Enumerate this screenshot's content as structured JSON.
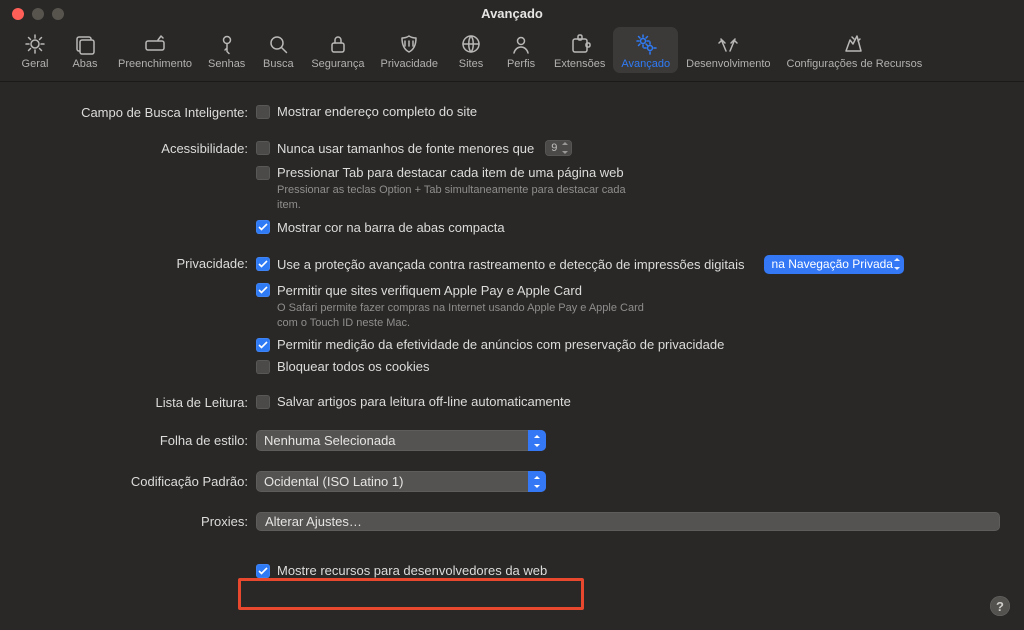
{
  "window": {
    "title": "Avançado"
  },
  "toolbar": [
    {
      "id": "general",
      "label": "Geral"
    },
    {
      "id": "tabs",
      "label": "Abas"
    },
    {
      "id": "autofill",
      "label": "Preenchimento"
    },
    {
      "id": "passwords",
      "label": "Senhas"
    },
    {
      "id": "search",
      "label": "Busca"
    },
    {
      "id": "security",
      "label": "Segurança"
    },
    {
      "id": "privacy",
      "label": "Privacidade"
    },
    {
      "id": "websites",
      "label": "Sites"
    },
    {
      "id": "profiles",
      "label": "Perfis"
    },
    {
      "id": "extensions",
      "label": "Extensões"
    },
    {
      "id": "advanced",
      "label": "Avançado",
      "active": true
    },
    {
      "id": "develop",
      "label": "Desenvolvimento"
    },
    {
      "id": "features",
      "label": "Configurações de Recursos"
    }
  ],
  "sections": {
    "smart_search": {
      "label": "Campo de Busca Inteligente:",
      "show_full_url": {
        "checked": false,
        "text": "Mostrar endereço completo do site"
      }
    },
    "accessibility": {
      "label": "Acessibilidade:",
      "min_font": {
        "checked": false,
        "text": "Nunca usar tamanhos de fonte menores que",
        "value": "9"
      },
      "tab_highlight": {
        "checked": false,
        "text": "Pressionar Tab para destacar cada item de uma página web",
        "help": "Pressionar as teclas Option + Tab simultaneamente para destacar cada item."
      },
      "compact_color": {
        "checked": true,
        "text": "Mostrar cor na barra de abas compacta"
      }
    },
    "privacy": {
      "label": "Privacidade:",
      "fingerprint": {
        "checked": true,
        "text": "Use a proteção avançada contra rastreamento e detecção de impressões digitais",
        "dropdown": "na Navegação Privada"
      },
      "apple_pay": {
        "checked": true,
        "text": "Permitir que sites verifiquem Apple Pay e Apple Card",
        "help": "O Safari permite fazer compras na Internet usando Apple Pay e Apple Card com o Touch ID neste Mac."
      },
      "ad_measure": {
        "checked": true,
        "text": "Permitir medição da efetividade de anúncios com preservação de privacidade"
      },
      "block_cookies": {
        "checked": false,
        "text": "Bloquear todos os cookies"
      }
    },
    "reading_list": {
      "label": "Lista de Leitura:",
      "offline": {
        "checked": false,
        "text": "Salvar artigos para leitura off-line automaticamente"
      }
    },
    "stylesheet": {
      "label": "Folha de estilo:",
      "value": "Nenhuma Selecionada"
    },
    "encoding": {
      "label": "Codificação Padrão:",
      "value": "Ocidental (ISO Latino 1)"
    },
    "proxies": {
      "label": "Proxies:",
      "button": "Alterar Ajustes…"
    },
    "dev_menu": {
      "checked": true,
      "text": "Mostre recursos para desenvolvedores da web"
    }
  },
  "help_button": "?"
}
